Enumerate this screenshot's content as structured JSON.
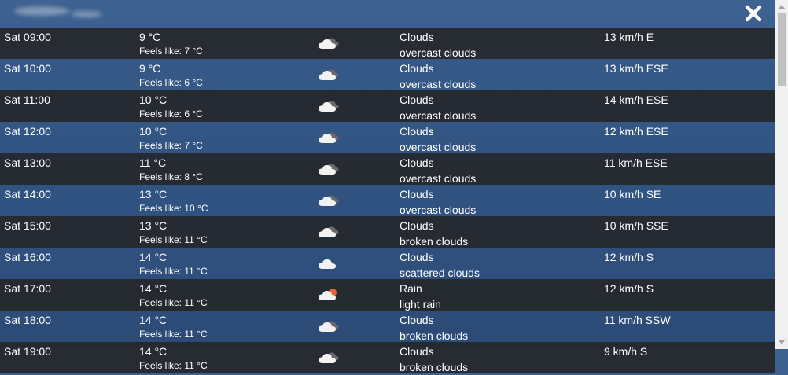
{
  "close_label": "close",
  "forecast": [
    {
      "time": "Sat 09:00",
      "temp": "9 °C",
      "feels": "Feels like: 7 °C",
      "icon": "overcast-clouds-icon",
      "main": "Clouds",
      "desc": "overcast clouds",
      "wind": "13 km/h E"
    },
    {
      "time": "Sat 10:00",
      "temp": "9 °C",
      "feels": "Feels like: 6 °C",
      "icon": "overcast-clouds-icon",
      "main": "Clouds",
      "desc": "overcast clouds",
      "wind": "13 km/h ESE"
    },
    {
      "time": "Sat 11:00",
      "temp": "10 °C",
      "feels": "Feels like: 6 °C",
      "icon": "overcast-clouds-icon",
      "main": "Clouds",
      "desc": "overcast clouds",
      "wind": "14 km/h ESE"
    },
    {
      "time": "Sat 12:00",
      "temp": "10 °C",
      "feels": "Feels like: 7 °C",
      "icon": "overcast-clouds-icon",
      "main": "Clouds",
      "desc": "overcast clouds",
      "wind": "12 km/h ESE"
    },
    {
      "time": "Sat 13:00",
      "temp": "11 °C",
      "feels": "Feels like: 8 °C",
      "icon": "overcast-clouds-icon",
      "main": "Clouds",
      "desc": "overcast clouds",
      "wind": "11 km/h ESE"
    },
    {
      "time": "Sat 14:00",
      "temp": "13 °C",
      "feels": "Feels like: 10 °C",
      "icon": "overcast-clouds-icon",
      "main": "Clouds",
      "desc": "overcast clouds",
      "wind": "10 km/h SE"
    },
    {
      "time": "Sat 15:00",
      "temp": "13 °C",
      "feels": "Feels like: 11 °C",
      "icon": "broken-clouds-icon",
      "main": "Clouds",
      "desc": "broken clouds",
      "wind": "10 km/h SSE"
    },
    {
      "time": "Sat 16:00",
      "temp": "14 °C",
      "feels": "Feels like: 11 °C",
      "icon": "scattered-clouds-icon",
      "main": "Clouds",
      "desc": "scattered clouds",
      "wind": "12 km/h S"
    },
    {
      "time": "Sat 17:00",
      "temp": "14 °C",
      "feels": "Feels like: 11 °C",
      "icon": "light-rain-icon",
      "main": "Rain",
      "desc": "light rain",
      "wind": "12 km/h S"
    },
    {
      "time": "Sat 18:00",
      "temp": "14 °C",
      "feels": "Feels like: 11 °C",
      "icon": "broken-clouds-icon",
      "main": "Clouds",
      "desc": "broken clouds",
      "wind": "11 km/h SSW"
    },
    {
      "time": "Sat 19:00",
      "temp": "14 °C",
      "feels": "Feels like: 11 °C",
      "icon": "broken-clouds-icon",
      "main": "Clouds",
      "desc": "broken clouds",
      "wind": "9 km/h S"
    }
  ]
}
